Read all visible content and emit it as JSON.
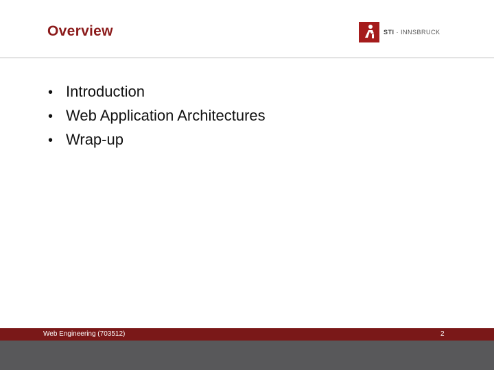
{
  "slide": {
    "title": "Overview",
    "bullets": [
      "Introduction",
      "Web Application Architectures",
      "Wrap-up"
    ]
  },
  "logo": {
    "brand": "STI",
    "separator": "·",
    "location": "INNSBRUCK",
    "mark_icon": "sti-logo-icon"
  },
  "footer": {
    "course": "Web Engineering (703512)",
    "page_number": "2"
  },
  "colors": {
    "title": "#8b1a1a",
    "logo_mark": "#a51c1c",
    "footer_bar": "#7a1818",
    "bottom_band": "#58585a"
  }
}
